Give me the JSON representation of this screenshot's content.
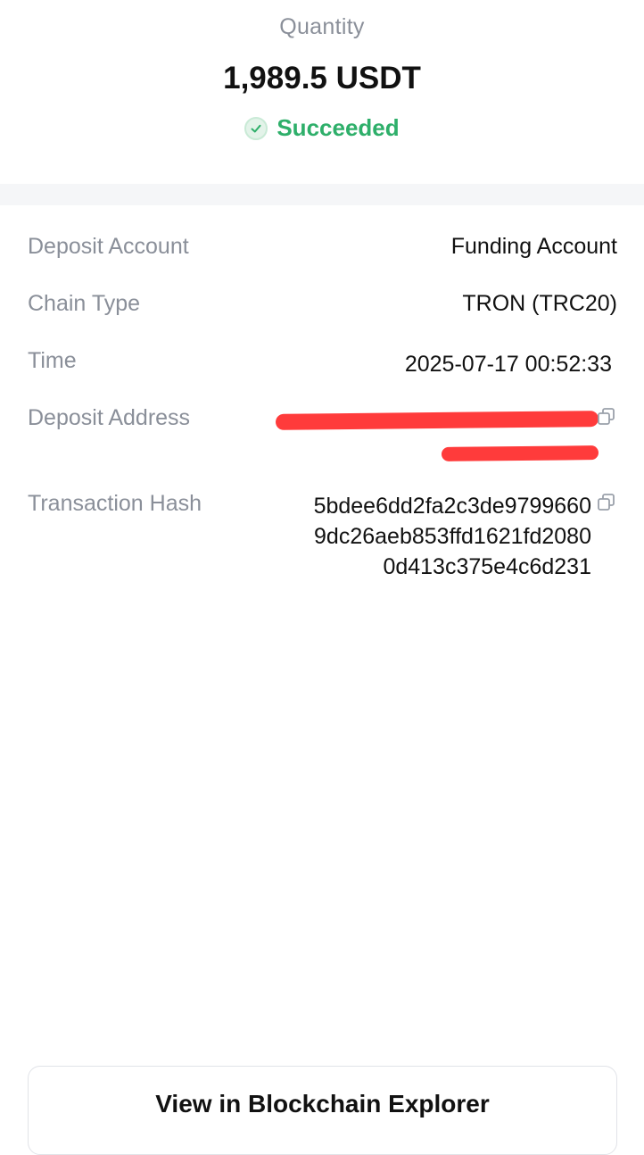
{
  "header": {
    "quantity_label": "Quantity",
    "quantity_value": "1,989.5 USDT",
    "status": "Succeeded",
    "status_color": "#2eaf6a",
    "status_icon": "check-circle-icon"
  },
  "details": {
    "deposit_account": {
      "label": "Deposit Account",
      "value": "Funding Account"
    },
    "chain_type": {
      "label": "Chain Type",
      "value": "TRON (TRC20)"
    },
    "time": {
      "label": "Time",
      "value": "2025-07-17 00:52:33"
    },
    "deposit_address": {
      "label": "Deposit Address",
      "value_redacted": true,
      "copy_icon": "copy-icon",
      "redaction_color": "#ff3b3b"
    },
    "transaction_hash": {
      "label": "Transaction Hash",
      "lines": [
        "5bdee6dd2fa2c3de9799660",
        "9dc26aeb853ffd1621fd2080",
        "0d413c375e4c6d231"
      ],
      "copy_icon": "copy-icon"
    }
  },
  "footer": {
    "explorer_button_label": "View in Blockchain Explorer"
  }
}
